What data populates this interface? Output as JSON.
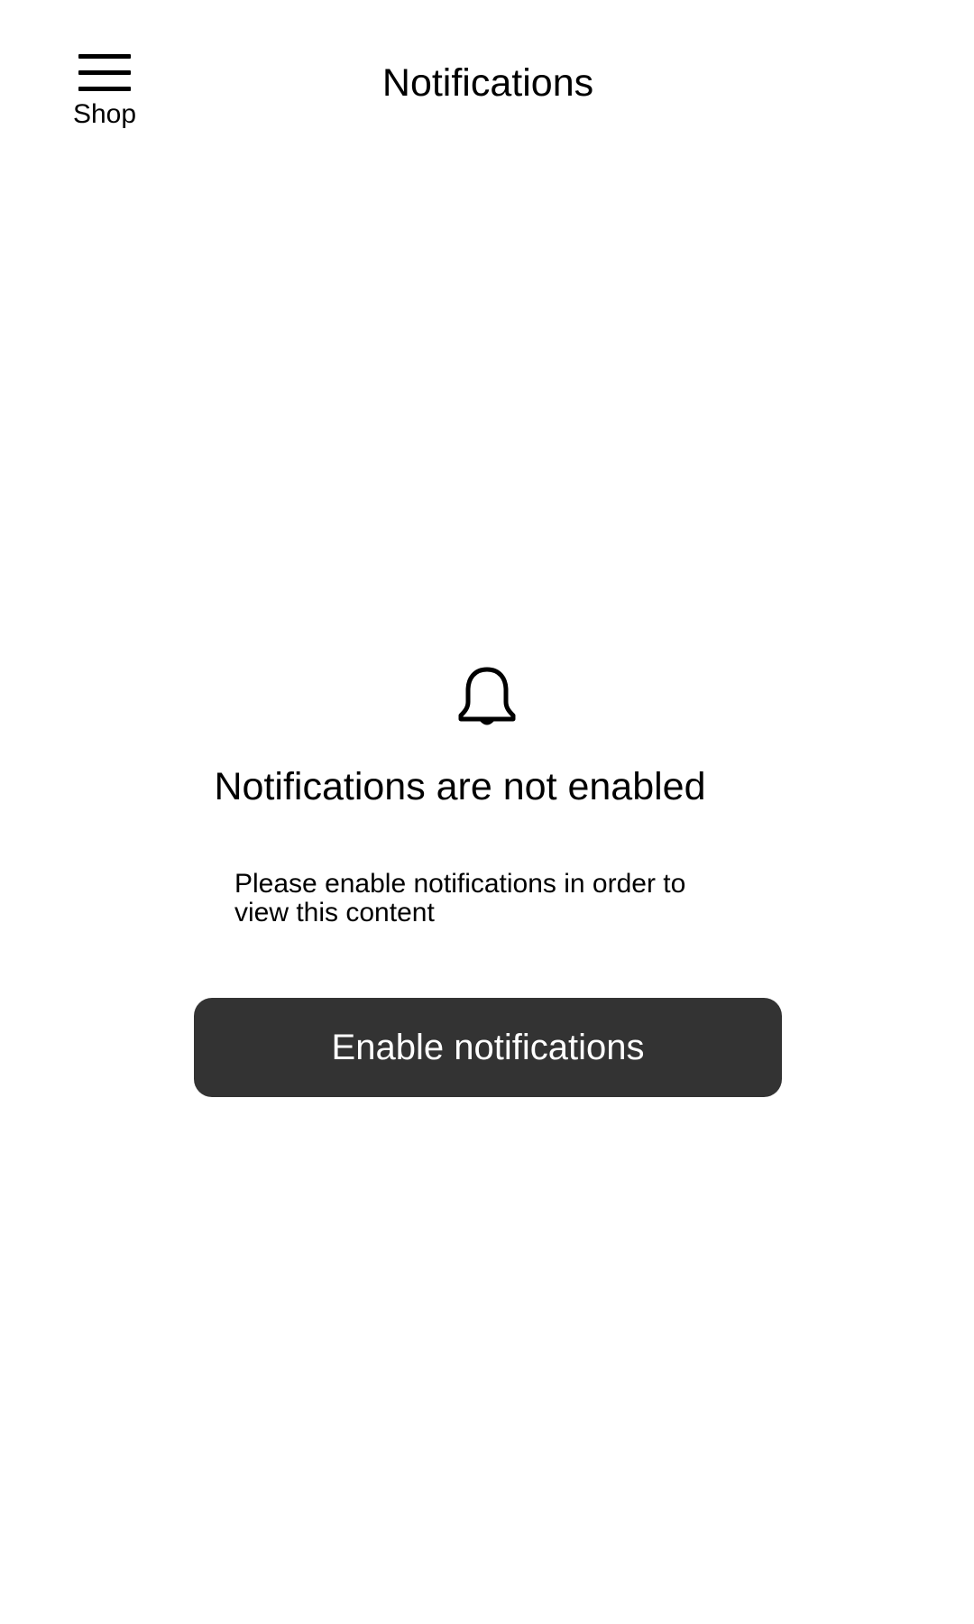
{
  "header": {
    "menu_label": "Shop",
    "menu_icon": "hamburger-icon",
    "title": "Notifications"
  },
  "empty_state": {
    "icon": "bell-icon",
    "title": "Notifications are not enabled",
    "message": "Please enable notifications in order to view this content",
    "button_label": "Enable notifications"
  },
  "colors": {
    "background": "#ffffff",
    "text": "#000000",
    "button_background": "#333333",
    "button_text": "#ffffff"
  }
}
